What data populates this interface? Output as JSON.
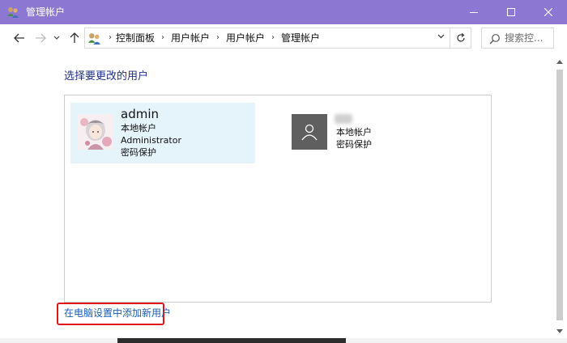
{
  "window": {
    "title": "管理帐户",
    "accent": "#8c78d2"
  },
  "address_bar": {
    "breadcrumbs": [
      "控制面板",
      "用户帐户",
      "用户帐户",
      "管理帐户"
    ],
    "separator": "›"
  },
  "search": {
    "placeholder": "搜索控..."
  },
  "main": {
    "heading": "选择要更改的用户",
    "accounts": [
      {
        "name": "admin",
        "details": [
          "本地帐户",
          "Administrator",
          "密码保护"
        ],
        "selected": true,
        "avatar": "user-photo-icon"
      },
      {
        "name": "",
        "details": [
          "本地帐户",
          "密码保护"
        ],
        "selected": false,
        "avatar": "default-user-icon"
      }
    ],
    "add_user_link": "在电脑设置中添加新用户"
  },
  "colors": {
    "heading": "#1e3287",
    "link": "#1a5fb4",
    "selected_tile": "#e5f3fb",
    "highlight_box": "#e01515"
  }
}
